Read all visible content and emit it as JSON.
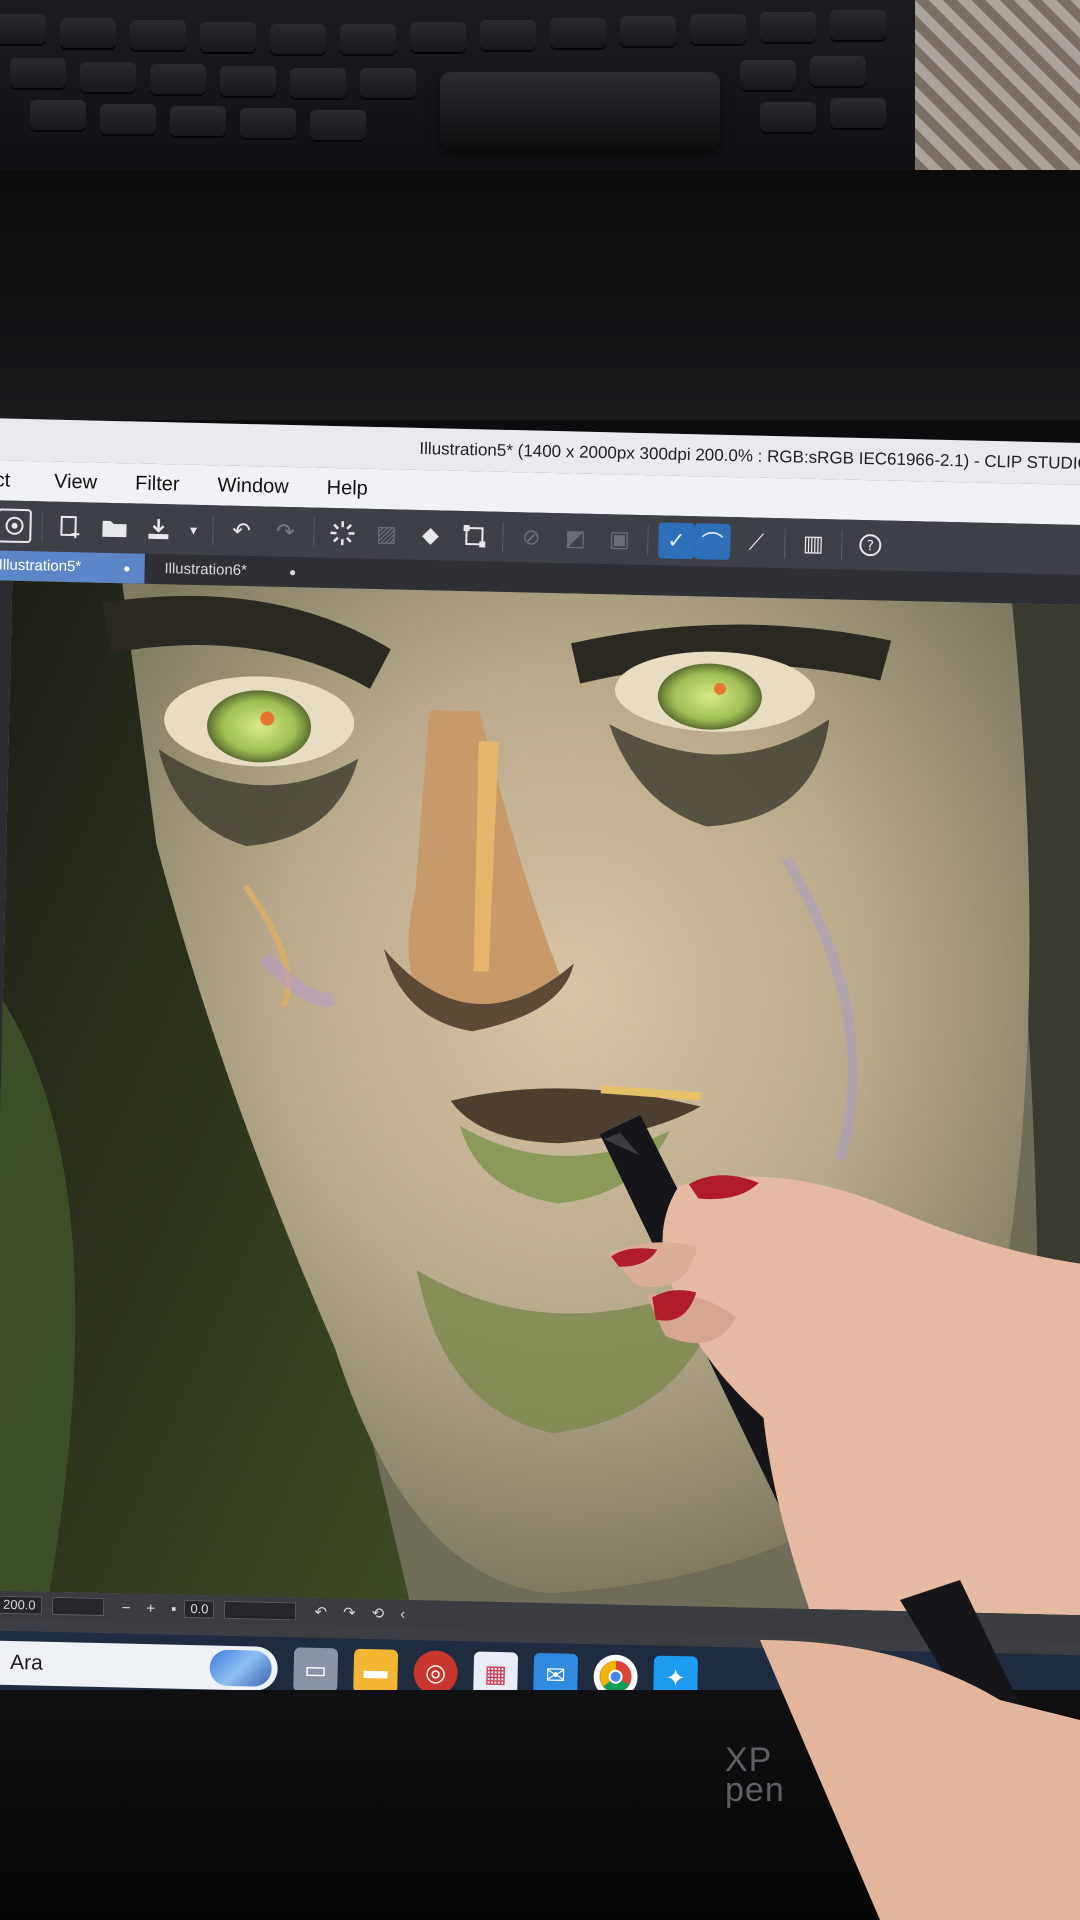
{
  "window": {
    "title": "Illustration5* (1400 x 2000px 300dpi 200.0% : RGB:sRGB IEC61966-2.1) - CLIP STUDIO PA"
  },
  "menu": {
    "items": [
      "ct",
      "View",
      "Filter",
      "Window",
      "Help"
    ]
  },
  "tabs": [
    {
      "label": "Illustration5*",
      "marker": "●"
    },
    {
      "label": "Illustration6*",
      "marker": "●"
    }
  ],
  "status_bar": {
    "zoom": "200.0",
    "rotation": "0.0"
  },
  "taskbar": {
    "search_placeholder": "Ara"
  },
  "tablet": {
    "brand_top": "XP",
    "brand_bottom": "pen"
  },
  "colors": {
    "accent": "#2d6fb8",
    "active_tab": "#5b87c9",
    "taskbar": "#1f2b3f",
    "skin": "#c9b28c",
    "eye": "#a7c35a",
    "nail": "#b01c28"
  },
  "icons": [
    "clip-studio-logo-icon",
    "new-canvas-icon",
    "open-folder-icon",
    "save-icon",
    "undo-icon",
    "redo-icon",
    "loading-spinner-icon",
    "fill-icon",
    "transform-icon",
    "pen-pressure-icon",
    "search-icon",
    "edge-browser-icon",
    "file-explorer-icon",
    "chrome-icon",
    "twitter-icon"
  ]
}
